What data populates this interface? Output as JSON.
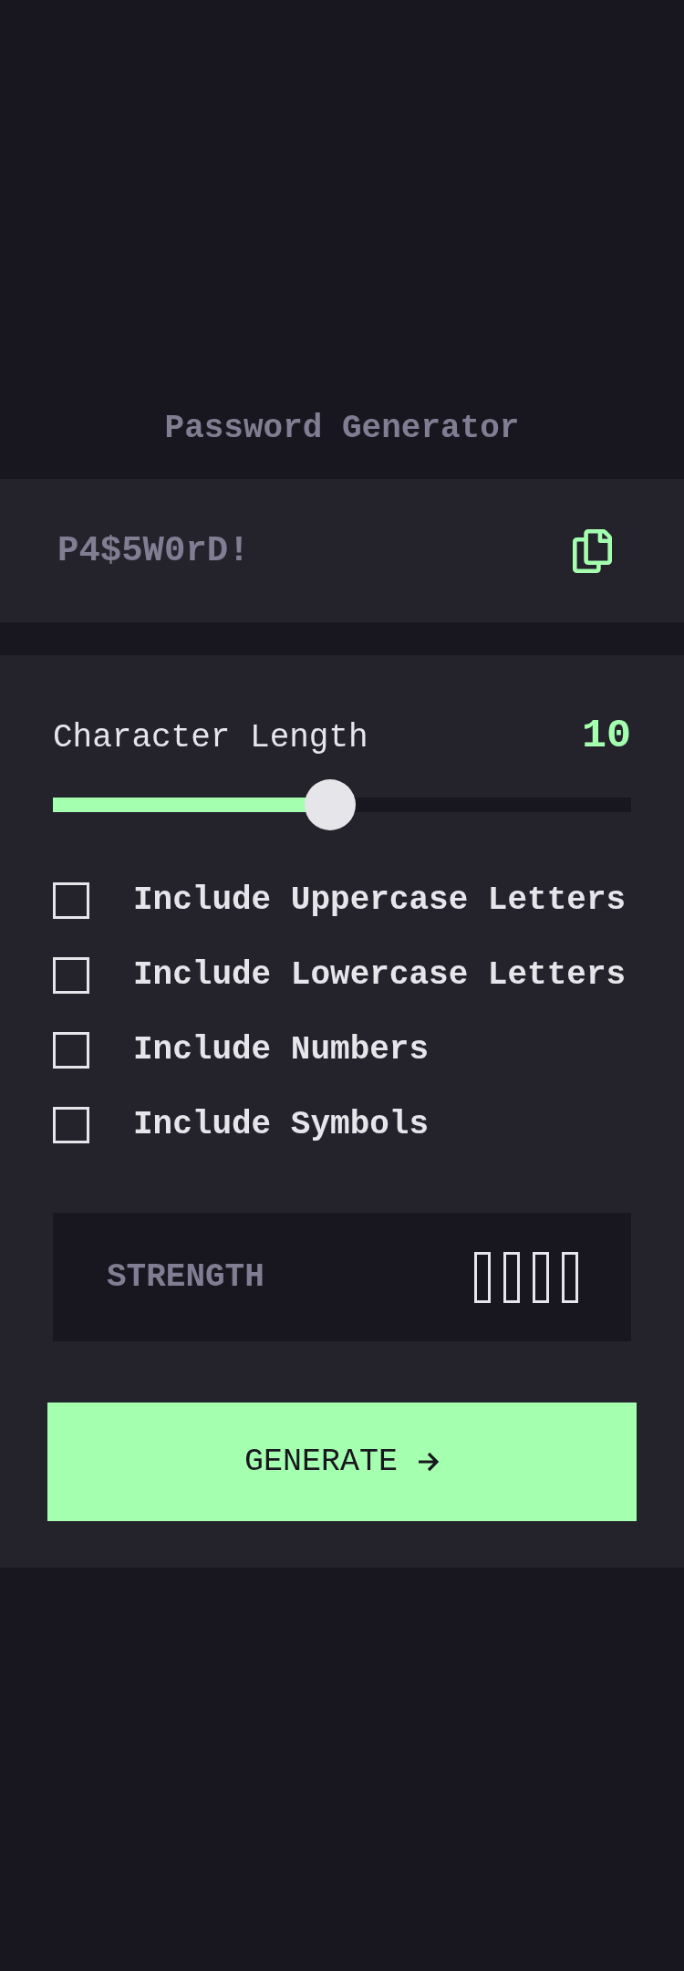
{
  "title": "Password Generator",
  "output": {
    "placeholder": "P4$5W0rD!"
  },
  "length": {
    "label": "Character Length",
    "value": "10",
    "level": 0.48
  },
  "options": [
    {
      "label": "Include Uppercase Letters",
      "checked": false
    },
    {
      "label": "Include Lowercase Letters",
      "checked": false
    },
    {
      "label": "Include Numbers",
      "checked": false
    },
    {
      "label": "Include Symbols",
      "checked": false
    }
  ],
  "strength": {
    "label": "STRENGTH",
    "bars": [
      {
        "filled": false
      },
      {
        "filled": false
      },
      {
        "filled": false
      },
      {
        "filled": false
      }
    ]
  },
  "generate": {
    "label": "GENERATE"
  }
}
